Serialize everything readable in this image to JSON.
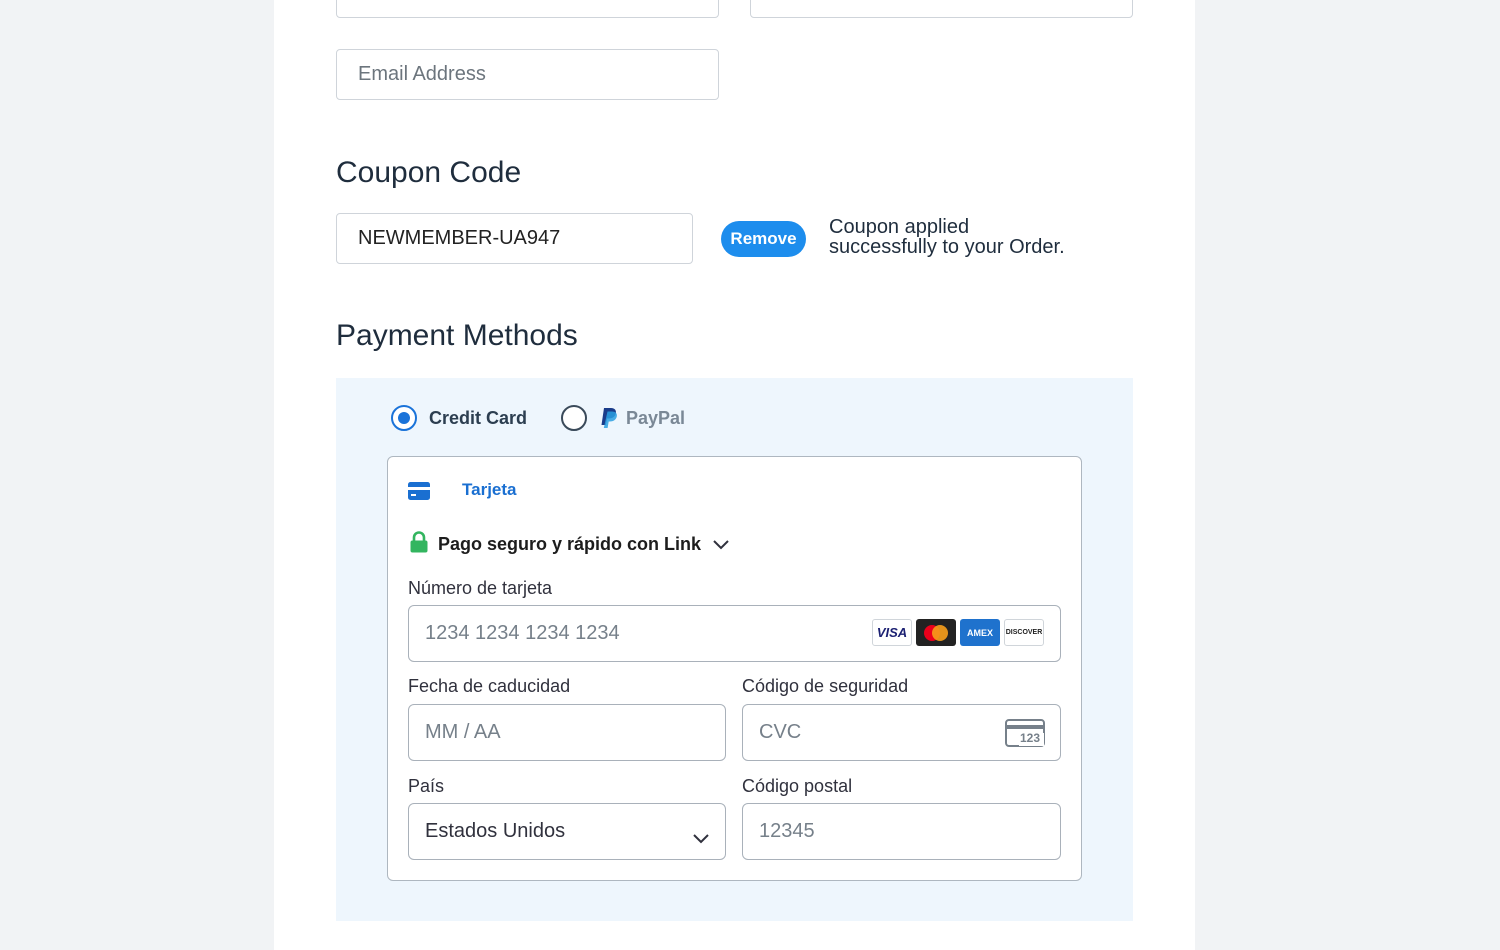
{
  "form": {
    "email_placeholder": "Email Address"
  },
  "coupon": {
    "heading": "Coupon Code",
    "code_value": "NEWMEMBER-UA947",
    "remove_label": "Remove",
    "message_line1": "Coupon applied",
    "message_line2": "successfully to your Order."
  },
  "payment": {
    "heading": "Payment Methods",
    "options": [
      {
        "label": "Credit Card",
        "selected": true
      },
      {
        "label": "PayPal",
        "selected": false
      }
    ],
    "card": {
      "tab_label": "Tarjeta",
      "link_text": "Pago seguro y rápido con Link",
      "number_label": "Número de tarjeta",
      "number_placeholder": "1234 1234 1234 1234",
      "brands": [
        "VISA",
        "mastercard",
        "AMEX",
        "DISCOVER"
      ],
      "expiry_label": "Fecha de caducidad",
      "expiry_placeholder": "MM / AA",
      "cvc_label": "Código de seguridad",
      "cvc_placeholder": "CVC",
      "cvc_icon_text": "123",
      "country_label": "País",
      "country_value": "Estados Unidos",
      "postal_label": "Código postal",
      "postal_placeholder": "12345"
    }
  },
  "colors": {
    "accent": "#1d8ded",
    "link_blue": "#1a73d9",
    "payment_bg": "#eef6fd",
    "lock_green": "#33b55f"
  }
}
